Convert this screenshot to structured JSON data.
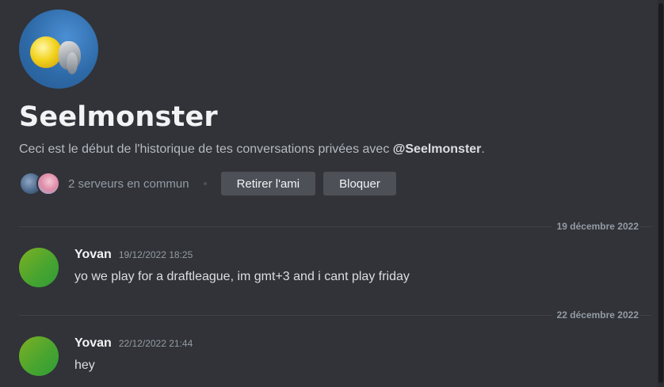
{
  "profile": {
    "name": "Seelmonster",
    "intro_prefix": "Ceci est le début de l'historique de tes conversations privées avec ",
    "intro_mention": "@Seelmonster",
    "intro_suffix": ".",
    "mutual_servers": "2 serveurs en commun",
    "remove_friend_label": "Retirer l'ami",
    "block_label": "Bloquer"
  },
  "messages": [
    {
      "date_divider": "19 décembre 2022",
      "author": "Yovan",
      "timestamp": "19/12/2022 18:25",
      "text": "yo we play for a draftleague, im gmt+3 and i cant play friday"
    },
    {
      "date_divider": "22 décembre 2022",
      "author": "Yovan",
      "timestamp": "22/12/2022 21:44",
      "text": "hey"
    }
  ],
  "colors": {
    "background": "#313338",
    "button": "#4e5058",
    "avatar_green": "#4aa52f"
  },
  "icons": {
    "profile_avatar": "pokemon-avatar",
    "server_1": "server-icon",
    "server_2": "server-icon",
    "message_avatar": "user-avatar"
  }
}
